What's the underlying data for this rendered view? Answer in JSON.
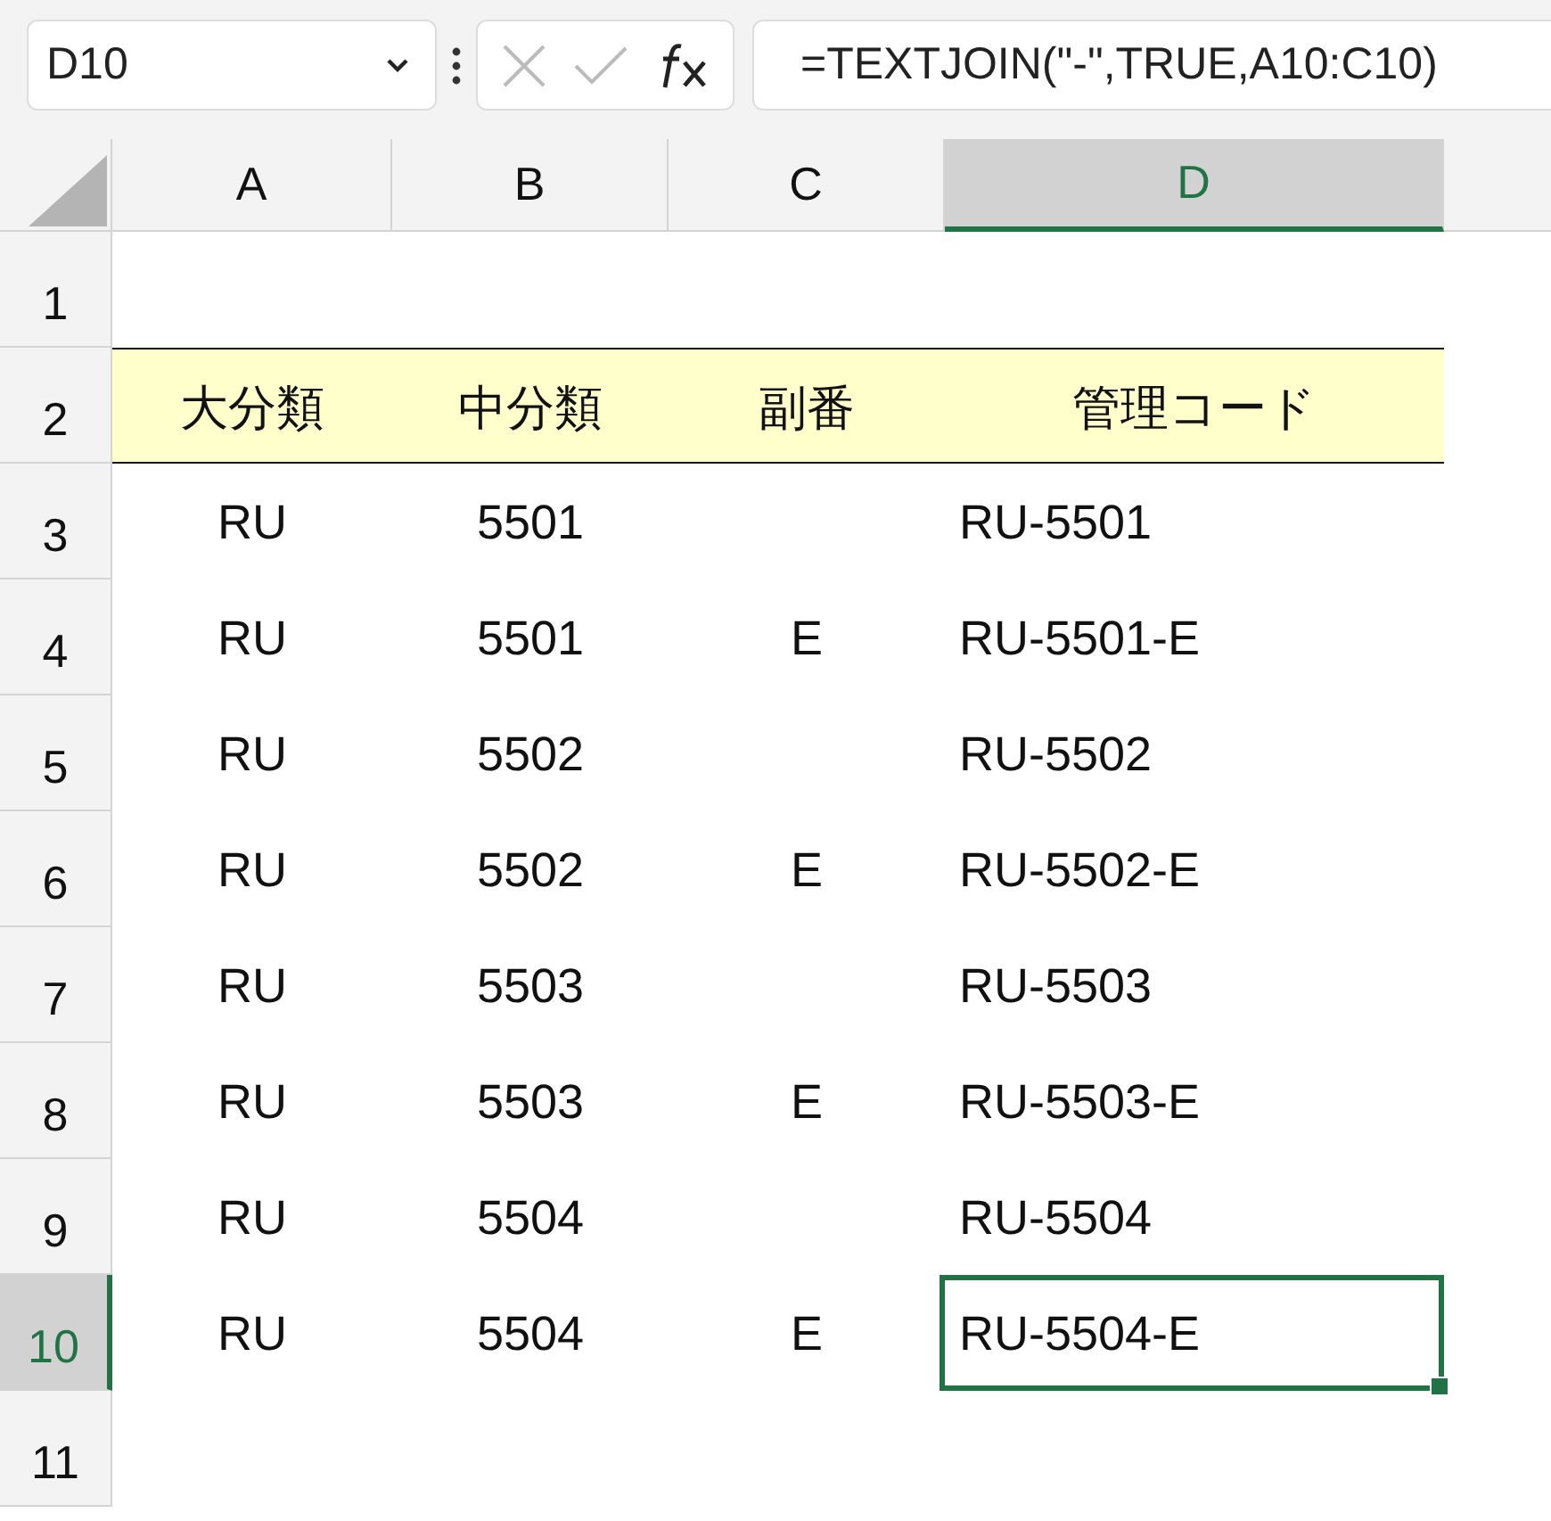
{
  "name_box": {
    "value": "D10"
  },
  "formula_bar": {
    "value": "=TEXTJOIN(\"-\",TRUE,A10:C10)"
  },
  "columns": [
    {
      "label": "A",
      "selected": false
    },
    {
      "label": "B",
      "selected": false
    },
    {
      "label": "C",
      "selected": false
    },
    {
      "label": "D",
      "selected": true
    }
  ],
  "rows": [
    {
      "number": "1",
      "selected": false,
      "kind": "data",
      "cells": []
    },
    {
      "number": "2",
      "selected": false,
      "kind": "header",
      "cells": [
        {
          "text": "大分類",
          "selected": false
        },
        {
          "text": "中分類",
          "selected": false
        },
        {
          "text": "副番",
          "selected": false
        },
        {
          "text": "管理コード",
          "selected": false
        }
      ]
    },
    {
      "number": "3",
      "selected": false,
      "kind": "data",
      "cells": [
        {
          "text": "RU",
          "selected": false
        },
        {
          "text": "5501",
          "selected": false
        },
        {
          "selected": false
        },
        {
          "text": "RU-5501",
          "selected": false
        }
      ]
    },
    {
      "number": "4",
      "selected": false,
      "kind": "data",
      "cells": [
        {
          "text": "RU",
          "selected": false
        },
        {
          "text": "5501",
          "selected": false
        },
        {
          "text": "E",
          "selected": false
        },
        {
          "text": "RU-5501-E",
          "selected": false
        }
      ]
    },
    {
      "number": "5",
      "selected": false,
      "kind": "data",
      "cells": [
        {
          "text": "RU",
          "selected": false
        },
        {
          "text": "5502",
          "selected": false
        },
        {
          "selected": false
        },
        {
          "text": "RU-5502",
          "selected": false
        }
      ]
    },
    {
      "number": "6",
      "selected": false,
      "kind": "data",
      "cells": [
        {
          "text": "RU",
          "selected": false
        },
        {
          "text": "5502",
          "selected": false
        },
        {
          "text": "E",
          "selected": false
        },
        {
          "text": "RU-5502-E",
          "selected": false
        }
      ]
    },
    {
      "number": "7",
      "selected": false,
      "kind": "data",
      "cells": [
        {
          "text": "RU",
          "selected": false
        },
        {
          "text": "5503",
          "selected": false
        },
        {
          "selected": false
        },
        {
          "text": "RU-5503",
          "selected": false
        }
      ]
    },
    {
      "number": "8",
      "selected": false,
      "kind": "data",
      "cells": [
        {
          "text": "RU",
          "selected": false
        },
        {
          "text": "5503",
          "selected": false
        },
        {
          "text": "E",
          "selected": false
        },
        {
          "text": "RU-5503-E",
          "selected": false
        }
      ]
    },
    {
      "number": "9",
      "selected": false,
      "kind": "data",
      "cells": [
        {
          "text": "RU",
          "selected": false
        },
        {
          "text": "5504",
          "selected": false
        },
        {
          "selected": false
        },
        {
          "text": "RU-5504",
          "selected": false
        }
      ]
    },
    {
      "number": "10",
      "selected": true,
      "kind": "data",
      "cells": [
        {
          "text": "RU",
          "selected": false
        },
        {
          "text": "5504",
          "selected": false
        },
        {
          "text": "E",
          "selected": false
        },
        {
          "text": "RU-5504-E",
          "selected": true
        }
      ]
    },
    {
      "number": "11",
      "selected": false,
      "kind": "data",
      "cells": []
    }
  ]
}
